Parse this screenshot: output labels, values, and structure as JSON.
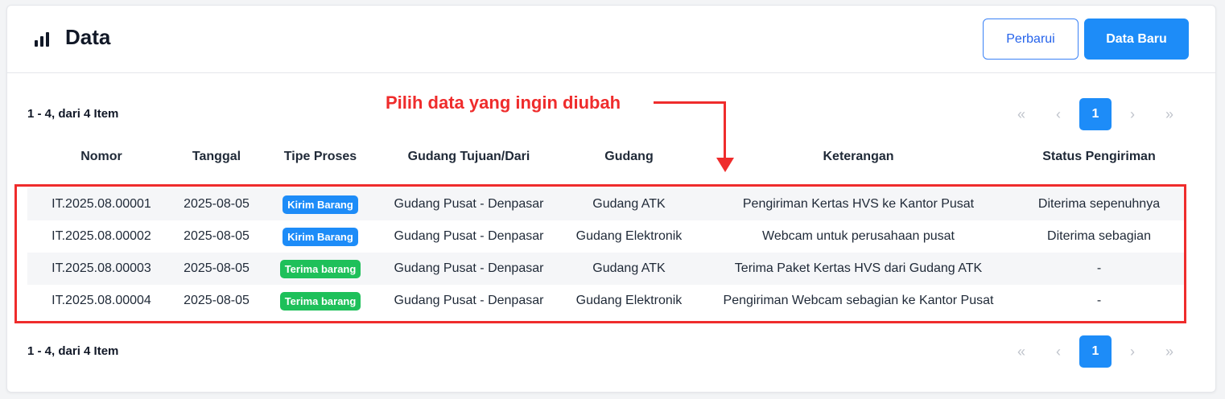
{
  "header": {
    "title": "Data",
    "title_icon": "bar-chart-icon",
    "buttons": {
      "refresh": "Perbarui",
      "new": "Data Baru"
    }
  },
  "pagination": {
    "range_text": "1 - 4, dari 4 Item",
    "first": "«",
    "prev": "‹",
    "current": "1",
    "next": "›",
    "last": "»"
  },
  "annotation": {
    "text": "Pilih data yang ingin diubah",
    "color": "#ef2c2c"
  },
  "table": {
    "columns": [
      "Nomor",
      "Tanggal",
      "Tipe Proses",
      "Gudang Tujuan/Dari",
      "Gudang",
      "Keterangan",
      "Status Pengiriman"
    ],
    "rows": [
      {
        "nomor": "IT.2025.08.00001",
        "tanggal": "2025-08-05",
        "tipe": "Kirim Barang",
        "tipe_color": "blue",
        "tujuan": "Gudang Pusat - Denpasar",
        "gudang": "Gudang ATK",
        "keterangan": "Pengiriman Kertas HVS ke Kantor Pusat",
        "status": "Diterima sepenuhnya"
      },
      {
        "nomor": "IT.2025.08.00002",
        "tanggal": "2025-08-05",
        "tipe": "Kirim Barang",
        "tipe_color": "blue",
        "tujuan": "Gudang Pusat - Denpasar",
        "gudang": "Gudang Elektronik",
        "keterangan": "Webcam untuk perusahaan pusat",
        "status": "Diterima sebagian"
      },
      {
        "nomor": "IT.2025.08.00003",
        "tanggal": "2025-08-05",
        "tipe": "Terima barang",
        "tipe_color": "green",
        "tujuan": "Gudang Pusat - Denpasar",
        "gudang": "Gudang ATK",
        "keterangan": "Terima Paket Kertas HVS dari Gudang ATK",
        "status": "-"
      },
      {
        "nomor": "IT.2025.08.00004",
        "tanggal": "2025-08-05",
        "tipe": "Terima barang",
        "tipe_color": "green",
        "tujuan": "Gudang Pusat - Denpasar",
        "gudang": "Gudang Elektronik",
        "keterangan": "Pengiriman Webcam sebagian ke Kantor Pusat",
        "status": "-"
      }
    ]
  },
  "colors": {
    "primary": "#1d8cf8",
    "success": "#1ec05a",
    "annotation": "#ef2c2c"
  }
}
